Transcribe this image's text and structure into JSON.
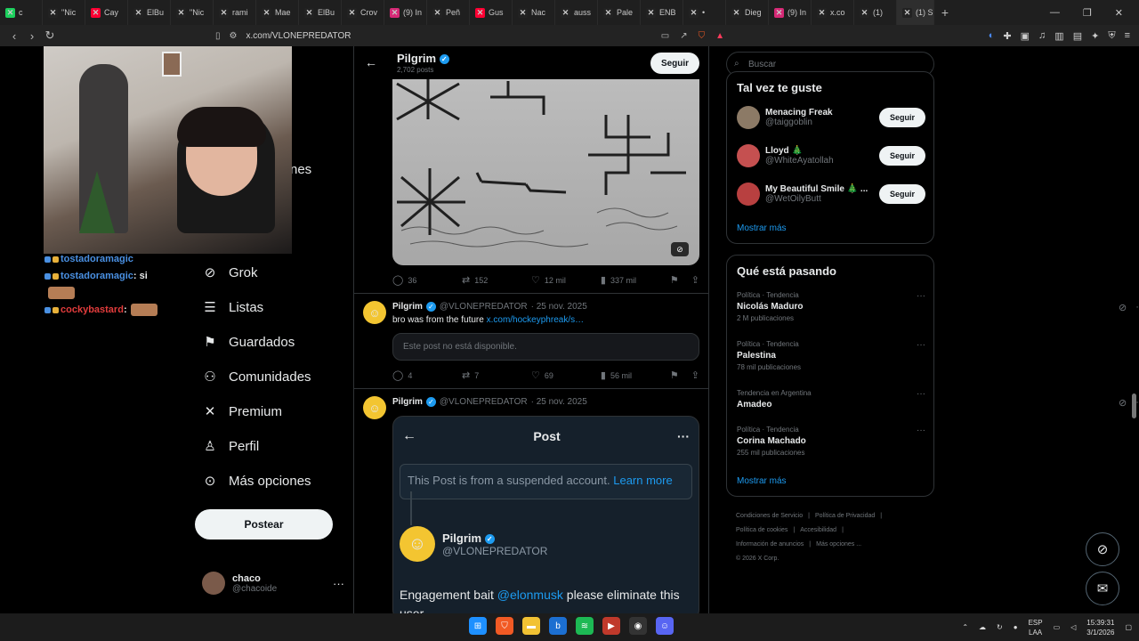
{
  "browser": {
    "tabs": [
      {
        "icon_color": "#1cd05d",
        "label": "c"
      },
      {
        "icon_color": "#222222",
        "label": "\"Nic"
      },
      {
        "icon_color": "#ff0033",
        "label": "Cay"
      },
      {
        "icon_color": "#222222",
        "label": "ElBu"
      },
      {
        "icon_color": "#222222",
        "label": "\"Nic"
      },
      {
        "icon_color": "#222222",
        "label": "rami"
      },
      {
        "icon_color": "#222222",
        "label": "Mae"
      },
      {
        "icon_color": "#222222",
        "label": "ElBu"
      },
      {
        "icon_color": "#222222",
        "label": "Crov"
      },
      {
        "icon_color": "#d62976",
        "label": "(9) In"
      },
      {
        "icon_color": "#222222",
        "label": "Peñ"
      },
      {
        "icon_color": "#ff0033",
        "label": "Gus"
      },
      {
        "icon_color": "#222222",
        "label": "Nac"
      },
      {
        "icon_color": "#222222",
        "label": "auss"
      },
      {
        "icon_color": "#222222",
        "label": "Pale"
      },
      {
        "icon_color": "#222222",
        "label": "ENB"
      },
      {
        "icon_color": "#222222",
        "label": "•"
      },
      {
        "icon_color": "#222222",
        "label": "Dieg"
      },
      {
        "icon_color": "#d62976",
        "label": "(9) In"
      },
      {
        "icon_color": "#222222",
        "label": "x.co"
      },
      {
        "icon_color": "#222222",
        "label": "(1)"
      },
      {
        "icon_color": "#222222",
        "label": "(1) S"
      }
    ],
    "new_tab": "+",
    "url": "x.com/VLONEPREDATOR"
  },
  "chat": [
    {
      "user": "tostadoramagic",
      "user_color": "#4a90e2",
      "text": ""
    },
    {
      "user": "tostadoramagic",
      "user_color": "#4a90e2",
      "text": ": si"
    },
    {
      "user": "cockybastard",
      "user_color": "#e23c3c",
      "text": ":"
    }
  ],
  "nav": {
    "peek_label": "nes",
    "items": [
      {
        "label": "Grok",
        "icon": "grok-icon"
      },
      {
        "label": "Listas",
        "icon": "lists-icon"
      },
      {
        "label": "Guardados",
        "icon": "bookmark-icon"
      },
      {
        "label": "Comunidades",
        "icon": "communities-icon"
      },
      {
        "label": "Premium",
        "icon": "x-logo-icon"
      },
      {
        "label": "Perfil",
        "icon": "profile-icon"
      },
      {
        "label": "Más opciones",
        "icon": "more-options-icon"
      }
    ],
    "post_button": "Postear",
    "account": {
      "name": "chaco",
      "handle": "@chacoide"
    }
  },
  "profile_header": {
    "name": "Pilgrim",
    "posts": "2,702 posts",
    "follow": "Seguir"
  },
  "tweets": [
    {
      "actions": {
        "replies": "36",
        "reposts": "152",
        "likes": "12 mil",
        "views": "337 mil"
      }
    },
    {
      "name": "Pilgrim",
      "handle": "@VLONEPREDATOR",
      "date": "· 25 nov. 2025",
      "text": "bro was from the future ",
      "link": "x.com/hockeyphreak/s…",
      "unavailable": "Este post no está disponible.",
      "actions": {
        "replies": "4",
        "reposts": "7",
        "likes": "69",
        "views": "56 mil"
      }
    },
    {
      "name": "Pilgrim",
      "handle": "@VLONEPREDATOR",
      "date": "· 25 nov. 2025",
      "embed": {
        "title": "Post",
        "notice": "This Post is from a suspended account. ",
        "learn_more": "Learn more",
        "user_name": "Pilgrim",
        "user_handle": "@VLONEPREDATOR",
        "body_pre": "Engagement bait ",
        "mention": "@elonmusk",
        "body_post": " please eliminate this user"
      }
    }
  ],
  "right": {
    "search_placeholder": "Buscar",
    "suggestions_title": "Tal vez te guste",
    "suggestions": [
      {
        "name": "Menacing Freak",
        "handle": "@taiggoblin",
        "button": "Seguir"
      },
      {
        "name": "Lloyd 🎄",
        "handle": "@WhiteAyatollah",
        "button": "Seguir"
      },
      {
        "name": "My Beautiful Smile 🎄 ...",
        "handle": "@WetOilyButt",
        "button": "Seguir"
      }
    ],
    "show_more": "Mostrar más",
    "trends_title": "Qué está pasando",
    "trends": [
      {
        "category": "Política · Tendencia",
        "name": "Nicolás Maduro",
        "posts": "2 M publicaciones"
      },
      {
        "category": "Política · Tendencia",
        "name": "Palestina",
        "posts": "78 mil publicaciones"
      },
      {
        "category": "Tendencia en Argentina",
        "name": "Amadeo",
        "posts": ""
      },
      {
        "category": "Política · Tendencia",
        "name": "Corina Machado",
        "posts": "255 mil publicaciones"
      }
    ],
    "trends_more": "Mostrar más",
    "footer": [
      "Condiciones de Servicio",
      "|",
      "Política de Privacidad",
      "|",
      "Política de cookies",
      "|",
      "Accesibilidad",
      "|",
      "Información de anuncios",
      "|",
      "Más opciones ...",
      "© 2026 X Corp."
    ]
  },
  "taskbar": {
    "lang_top": "ESP",
    "lang_bottom": "LAA",
    "time": "15:39:31",
    "date": "3/1/2026"
  }
}
